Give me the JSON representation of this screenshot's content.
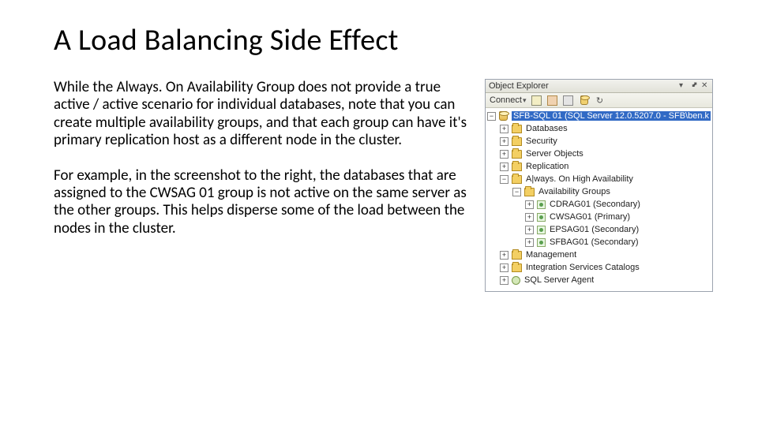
{
  "title": "A Load Balancing Side Effect",
  "body": {
    "p1": "While the Always. On Availability Group does not provide a true active / active scenario for individual databases, note that you can create multiple availability groups, and that each group can have it's primary replication host as a different node in the cluster.",
    "p2": "For example, in the screenshot to the right, the databases that are assigned to the CWSAG 01 group is not active on the same server as the other groups.  This helps disperse some of the load between the nodes in the cluster."
  },
  "explorer": {
    "header": "Object Explorer",
    "toolbar_connect": "Connect",
    "root": "SFB-SQL 01 (SQL Server 12.0.5207.0 - SFB\\ben.k",
    "nodes": {
      "databases": "Databases",
      "security": "Security",
      "server_objects": "Server Objects",
      "replication": "Replication",
      "ha": "A|ways. On High Availability",
      "ag_folder": "Availability Groups",
      "ag1": "CDRAG01 (Secondary)",
      "ag2": "CWSAG01 (Primary)",
      "ag3": "EPSAG01 (Secondary)",
      "ag4": "SFBAG01 (Secondary)",
      "management": "Management",
      "isc": "Integration Services Catalogs",
      "agent": "SQL Server Agent"
    }
  }
}
